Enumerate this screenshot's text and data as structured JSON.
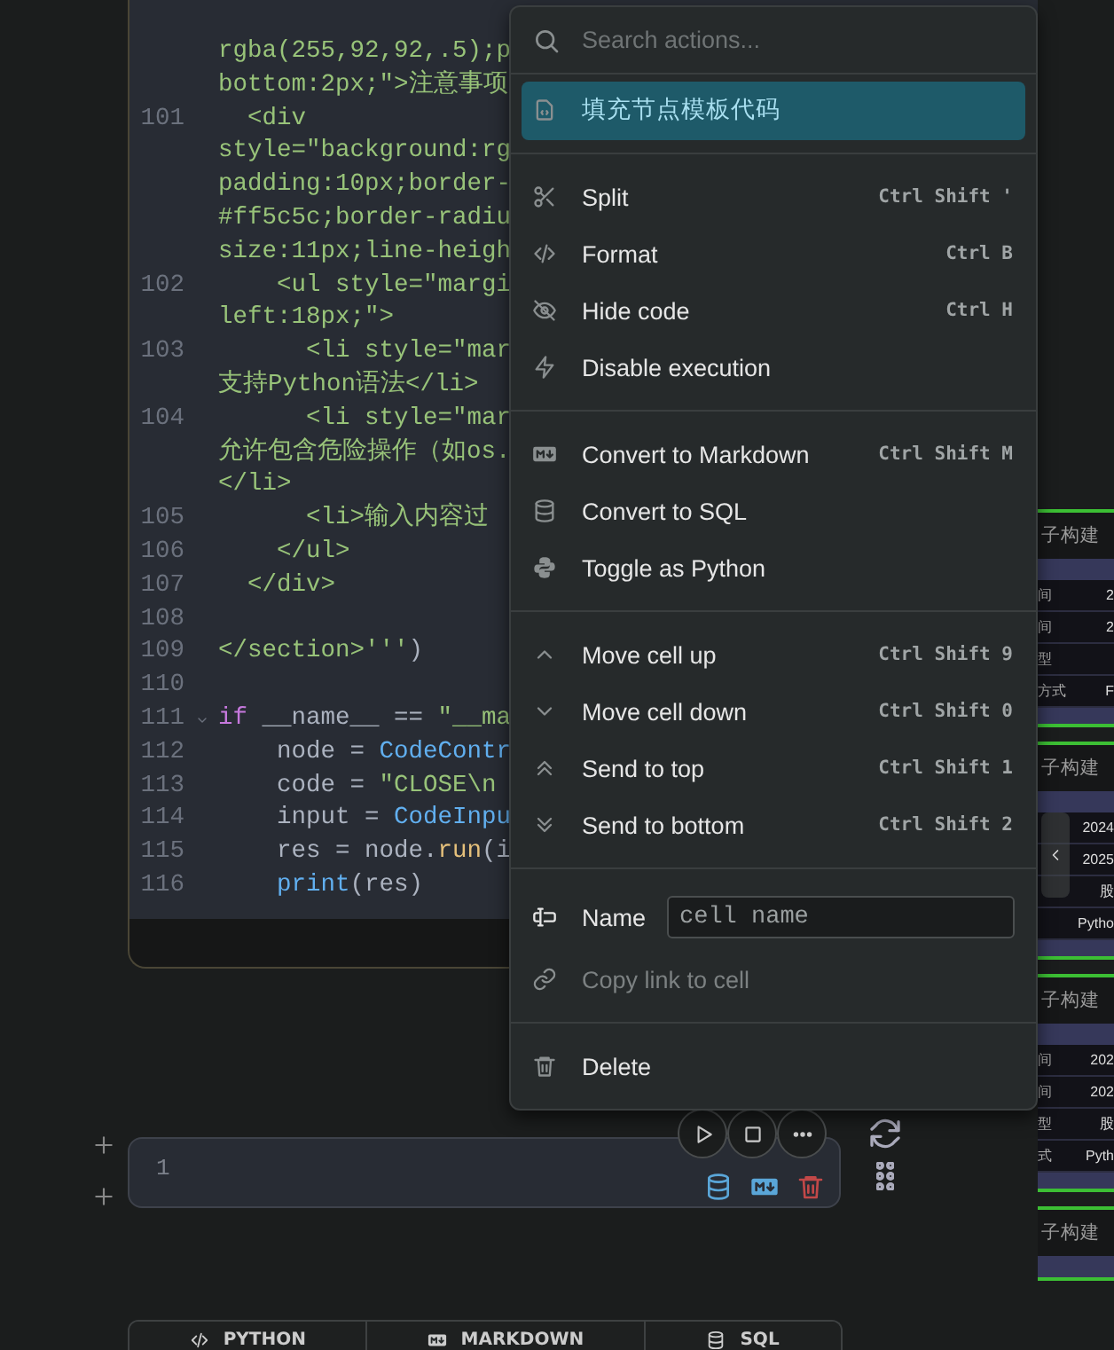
{
  "code_cell": {
    "lines": [
      {
        "fold": false,
        "segments": [
          {
            "kind": "str",
            "text": "rgba(255,92,92,.5);p"
          }
        ]
      },
      {
        "fold": false,
        "segments": [
          {
            "kind": "str",
            "text": "bottom:2px;\">注意事项"
          }
        ]
      },
      {
        "number": "101",
        "fold": false,
        "segments": [
          {
            "kind": "str",
            "text": "  <div"
          }
        ]
      },
      {
        "fold": false,
        "segments": [
          {
            "kind": "str",
            "text": "style=\"background:rg"
          }
        ]
      },
      {
        "fold": false,
        "segments": [
          {
            "kind": "str",
            "text": "padding:10px;border-"
          }
        ]
      },
      {
        "fold": false,
        "segments": [
          {
            "kind": "str",
            "text": "#ff5c5c;border-radiu"
          }
        ]
      },
      {
        "fold": false,
        "segments": [
          {
            "kind": "str",
            "text": "size:11px;line-heigh"
          }
        ]
      },
      {
        "number": "102",
        "fold": false,
        "segments": [
          {
            "kind": "str",
            "text": "    <ul style=\"margi"
          }
        ]
      },
      {
        "fold": false,
        "segments": [
          {
            "kind": "str",
            "text": "left:18px;\">"
          }
        ]
      },
      {
        "number": "103",
        "fold": false,
        "segments": [
          {
            "kind": "str",
            "text": "      <li style=\"mar"
          }
        ]
      },
      {
        "fold": false,
        "segments": [
          {
            "kind": "str",
            "text": "支持Python语法</li>"
          }
        ]
      },
      {
        "number": "104",
        "fold": false,
        "segments": [
          {
            "kind": "str",
            "text": "      <li style=\"mar"
          }
        ]
      },
      {
        "fold": false,
        "segments": [
          {
            "kind": "str",
            "text": "允许包含危险操作（如os."
          }
        ]
      },
      {
        "fold": false,
        "segments": [
          {
            "kind": "str",
            "text": "</li>"
          }
        ]
      },
      {
        "number": "105",
        "fold": false,
        "segments": [
          {
            "kind": "str",
            "text": "      <li>输入内容过"
          }
        ]
      },
      {
        "number": "106",
        "fold": false,
        "segments": [
          {
            "kind": "str",
            "text": "    </ul>"
          }
        ]
      },
      {
        "number": "107",
        "fold": false,
        "segments": [
          {
            "kind": "str",
            "text": "  </div>"
          }
        ]
      },
      {
        "number": "108",
        "fold": false
      },
      {
        "number": "109",
        "fold": false,
        "segments": [
          {
            "kind": "str",
            "text": "</section>'''"
          },
          {
            "kind": "plain",
            "text": ")"
          }
        ]
      },
      {
        "number": "110",
        "fold": false
      },
      {
        "number": "111",
        "fold": true,
        "segments": [
          {
            "kind": "kw",
            "text": "if"
          },
          {
            "kind": "plain",
            "text": " __name__ == "
          },
          {
            "kind": "str",
            "text": "\"__ma"
          }
        ]
      },
      {
        "number": "112",
        "fold": false,
        "segments": [
          {
            "kind": "plain",
            "text": "    node = "
          },
          {
            "kind": "cls",
            "text": "CodeContr"
          }
        ]
      },
      {
        "number": "113",
        "fold": false,
        "segments": [
          {
            "kind": "plain",
            "text": "    code = "
          },
          {
            "kind": "str",
            "text": "\"CLOSE\\n"
          }
        ]
      },
      {
        "number": "114",
        "fold": false,
        "segments": [
          {
            "kind": "plain",
            "text": "    input = "
          },
          {
            "kind": "cls",
            "text": "CodeInpu"
          }
        ]
      },
      {
        "number": "115",
        "fold": false,
        "segments": [
          {
            "kind": "plain",
            "text": "    res = node."
          },
          {
            "kind": "fn",
            "text": "run"
          },
          {
            "kind": "plain",
            "text": "(i"
          }
        ]
      },
      {
        "number": "116",
        "fold": false,
        "segments": [
          {
            "kind": "cls",
            "text": "    print"
          },
          {
            "kind": "plain",
            "text": "(res)"
          }
        ]
      }
    ]
  },
  "action_menu": {
    "search": {
      "placeholder": "Search actions..."
    },
    "groups": [
      [
        {
          "kind": "action",
          "label": "填充节点模板代码",
          "selected": true,
          "disabled": false
        }
      ],
      [
        {
          "kind": "action",
          "label": "Split",
          "shortcut": "Ctrl Shift '",
          "selected": false,
          "disabled": false
        },
        {
          "kind": "action",
          "label": "Format",
          "shortcut": "Ctrl B",
          "selected": false,
          "disabled": false
        },
        {
          "kind": "action",
          "label": "Hide code",
          "shortcut": "Ctrl H",
          "selected": false,
          "disabled": false
        },
        {
          "kind": "action",
          "label": "Disable execution",
          "selected": false,
          "disabled": false
        }
      ],
      [
        {
          "kind": "action",
          "label": "Convert to Markdown",
          "shortcut": "Ctrl Shift M",
          "selected": false,
          "disabled": false
        },
        {
          "kind": "action",
          "label": "Convert to SQL",
          "selected": false,
          "disabled": false
        },
        {
          "kind": "action",
          "label": "Toggle as Python",
          "selected": false,
          "disabled": false
        }
      ],
      [
        {
          "kind": "action",
          "label": "Move cell up",
          "shortcut": "Ctrl Shift 9",
          "selected": false,
          "disabled": false
        },
        {
          "kind": "action",
          "label": "Move cell down",
          "shortcut": "Ctrl Shift 0",
          "selected": false,
          "disabled": false
        },
        {
          "kind": "action",
          "label": "Send to top",
          "shortcut": "Ctrl Shift 1",
          "selected": false,
          "disabled": false
        },
        {
          "kind": "action",
          "label": "Send to bottom",
          "shortcut": "Ctrl Shift 2",
          "selected": false,
          "disabled": false
        }
      ],
      [
        {
          "kind": "input",
          "label": "Name",
          "placeholder": "cell name"
        },
        {
          "kind": "action",
          "label": "Copy link to cell",
          "selected": false,
          "disabled": true
        }
      ],
      [
        {
          "kind": "action",
          "label": "Delete",
          "selected": false,
          "disabled": false
        }
      ]
    ]
  },
  "side_panel": {
    "cards": [
      {
        "title": "子构建",
        "rows": [
          {
            "label": "间",
            "value": "2"
          },
          {
            "label": "间",
            "value": "2"
          },
          {
            "label": "型"
          },
          {
            "label": "方式",
            "value": "F"
          }
        ]
      },
      {
        "title": "子构建",
        "rows": [
          {
            "value": "2024"
          },
          {
            "value": "2025"
          },
          {
            "value": "股"
          },
          {
            "value": "Pytho"
          }
        ]
      },
      {
        "title": "子构建",
        "rows": [
          {
            "label": "间",
            "value": "202"
          },
          {
            "label": "间",
            "value": "202"
          },
          {
            "label": "型",
            "value": "股"
          },
          {
            "label": "式",
            "value": "Pyth"
          }
        ]
      },
      {
        "title": "子构建"
      }
    ]
  },
  "new_cell": {
    "line_number": "1"
  },
  "cell_type_tabs": [
    {
      "label": "PYTHON"
    },
    {
      "label": "MARKDOWN"
    },
    {
      "label": "SQL"
    }
  ]
}
